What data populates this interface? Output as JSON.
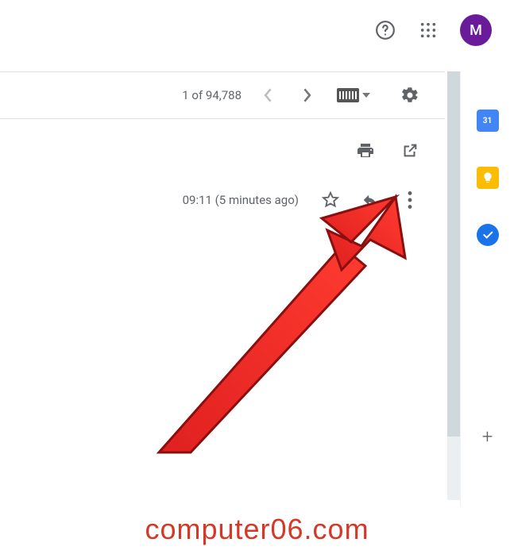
{
  "header": {
    "avatar_initial": "M"
  },
  "toolbar": {
    "count_text": "1 of 94,788"
  },
  "message": {
    "timestamp": "09:11 (5 minutes ago)"
  },
  "sidepanel": {
    "calendar_day": "31",
    "add_label": "+"
  },
  "watermark": "computer06.com"
}
